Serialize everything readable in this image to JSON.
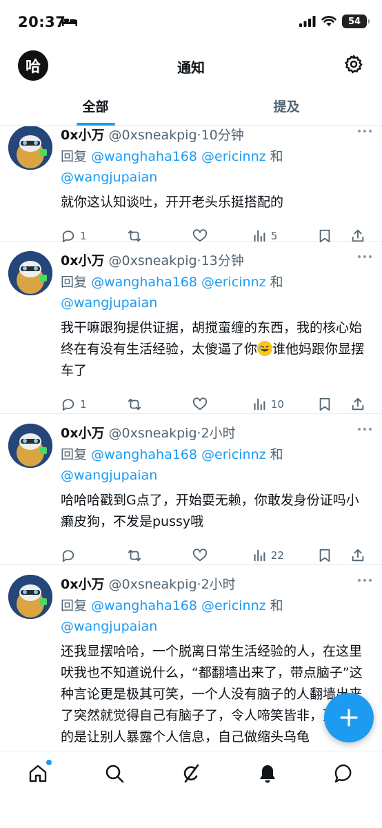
{
  "status_bar": {
    "time": "20:37",
    "battery": "54"
  },
  "header": {
    "logo_text": "哈",
    "title": "通知"
  },
  "tabs": [
    {
      "label": "全部",
      "active": true
    },
    {
      "label": "提及",
      "active": false
    }
  ],
  "colors": {
    "accent": "#1d9bf0",
    "text": "#0f1419",
    "secondary": "#536471"
  },
  "posts": [
    {
      "name": "0x小万",
      "handle": "@0xsneakpig",
      "time": "10分钟",
      "sep": "·",
      "reply_prefix": "回复",
      "mention1": "@wanghaha168",
      "mention2": "@ericinnz",
      "reply_and": "和",
      "mention3": "@wangjupaian",
      "text": "就你这认知谈吐，开开老头乐挺搭配的",
      "replies": "1",
      "retweets": "",
      "likes": "",
      "views": "5"
    },
    {
      "name": "0x小万",
      "handle": "@0xsneakpig",
      "time": "13分钟",
      "sep": "·",
      "reply_prefix": "回复",
      "mention1": "@wanghaha168",
      "mention2": "@ericinnz",
      "reply_and": "和",
      "mention3": "@wangjupaian",
      "text_a": "我干嘛跟狗提供证据，胡搅蛮缠的东西，我的核心始终在有没有生活经验，太傻逼了你",
      "text_b": "谁他妈跟你显摆车了",
      "replies": "1",
      "retweets": "",
      "likes": "",
      "views": "10"
    },
    {
      "name": "0x小万",
      "handle": "@0xsneakpig",
      "time": "2小时",
      "sep": "·",
      "reply_prefix": "回复",
      "mention1": "@wanghaha168",
      "mention2": "@ericinnz",
      "reply_and": "和",
      "mention3": "@wangjupaian",
      "text": "哈哈哈戳到G点了，开始耍无赖，你敢发身份证吗小癞皮狗，不发是pussy哦",
      "replies": "",
      "retweets": "",
      "likes": "",
      "views": "22"
    },
    {
      "name": "0x小万",
      "handle": "@0xsneakpig",
      "time": "2小时",
      "sep": "·",
      "reply_prefix": "回复",
      "mention1": "@wanghaha168",
      "mention2": "@ericinnz",
      "reply_and": "和",
      "mention3": "@wangjupaian",
      "text": "还我显摆哈哈，一个脱离日常生活经验的人，在这里吠我也不知道说什么，“都翻墙出来了，带点脑子”这种言论更是极其可笑，一个人没有脑子的人翻墙出来了突然就觉得自己有脑子了，令人啼笑皆非，更可笑的是让别人暴露个人信息，自己做缩头乌龟"
    }
  ],
  "icons": {
    "header": [
      "gear-icon"
    ],
    "actions": [
      "reply-icon",
      "retweet-icon",
      "heart-icon",
      "views-icon",
      "bookmark-icon",
      "share-icon"
    ],
    "nav": [
      "home-icon",
      "search-icon",
      "grok-icon",
      "bell-icon",
      "messages-icon"
    ],
    "fab": "plus-icon"
  }
}
